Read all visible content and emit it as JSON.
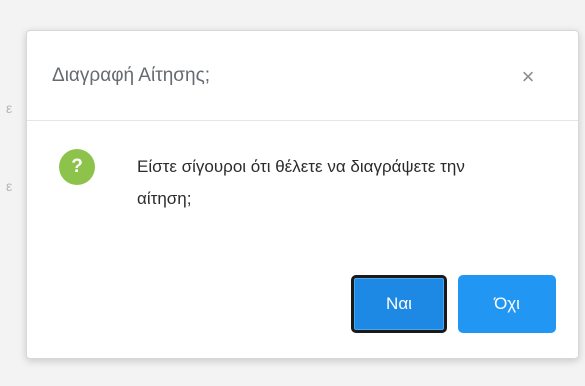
{
  "backdrop": {
    "fragment_1": "ε",
    "fragment_2": "ε"
  },
  "dialog": {
    "title": "Διαγραφή Αίτησης;",
    "close_glyph": "×",
    "icon_glyph": "?",
    "message": "Είστε σίγουροι ότι θέλετε να διαγράψετε την αίτηση;",
    "confirm_label": "Ναι",
    "cancel_label": "Όχι"
  },
  "colors": {
    "icon_green": "#8dc24b",
    "button_blue": "#2196f3",
    "focused_border": "#1a1a1a"
  },
  "icons": [
    "close-icon",
    "question-icon"
  ]
}
